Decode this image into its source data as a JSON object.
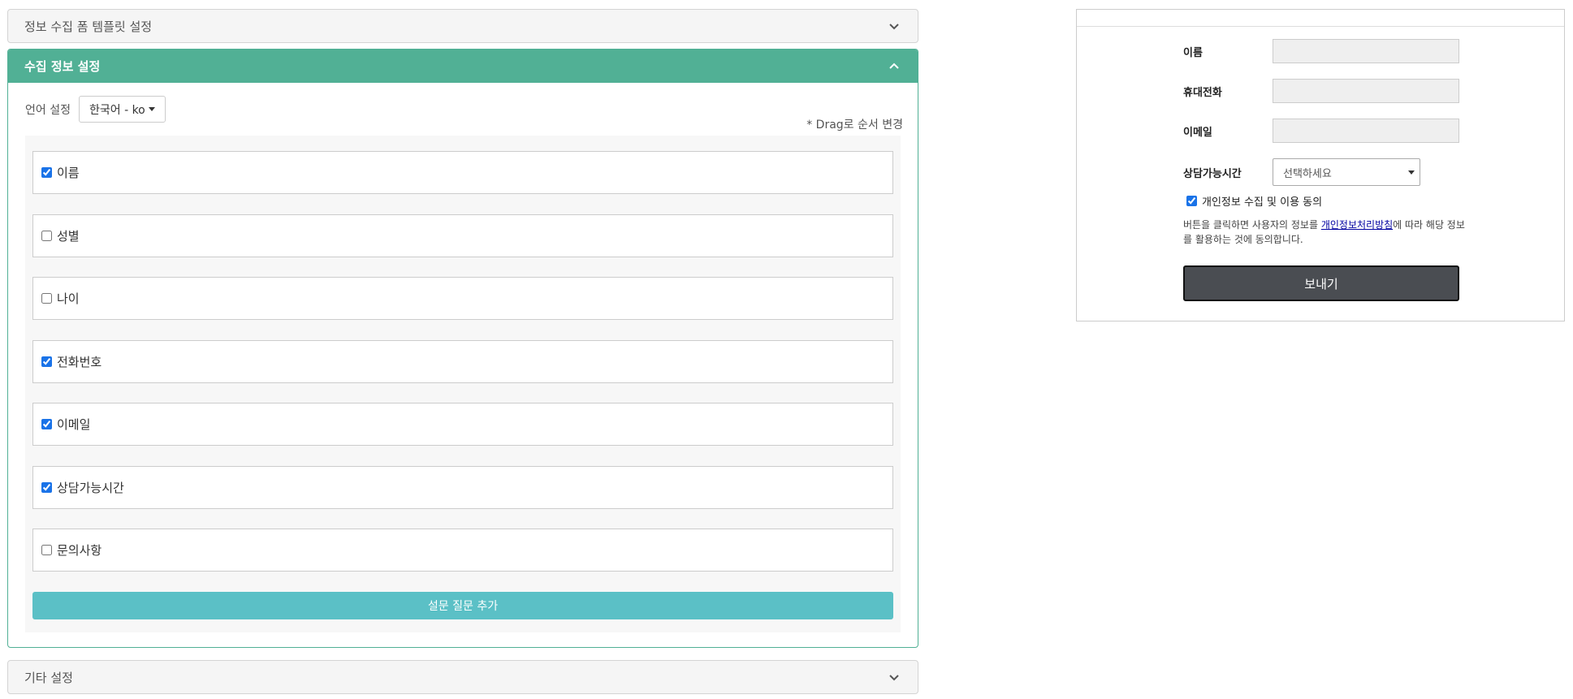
{
  "template_panel": {
    "title": "정보 수집 폼 템플릿 설정"
  },
  "collect_panel": {
    "title": "수집 정보 설정",
    "language_label": "언어 설정",
    "language_value": "한국어 - ko",
    "drag_hint": "* Drag로 순서 변경",
    "fields": [
      {
        "label": "이름",
        "checked": true
      },
      {
        "label": "성별",
        "checked": false
      },
      {
        "label": "나이",
        "checked": false
      },
      {
        "label": "전화번호",
        "checked": true
      },
      {
        "label": "이메일",
        "checked": true
      },
      {
        "label": "상담가능시간",
        "checked": true
      },
      {
        "label": "문의사항",
        "checked": false
      }
    ],
    "add_button": "설문 질문 추가"
  },
  "other_panel": {
    "title": "기타 설정"
  },
  "preview": {
    "name_label": "이름",
    "phone_label": "휴대전화",
    "email_label": "이메일",
    "time_label": "상담가능시간",
    "time_select_value": "선택하세요",
    "consent_label": "개인정보 수집 및 이용 동의",
    "consent_checked": true,
    "notice_before": "버튼을 클릭하면 사용자의 정보를 ",
    "notice_link": "개인정보처리방침",
    "notice_after": "에 따라 해당 정보를 활용하는 것에 동의합니다.",
    "submit_button": "보내기"
  },
  "colors": {
    "accent_green": "#51b095",
    "add_button": "#5bc0c6",
    "submit_button": "#4a4d52"
  }
}
